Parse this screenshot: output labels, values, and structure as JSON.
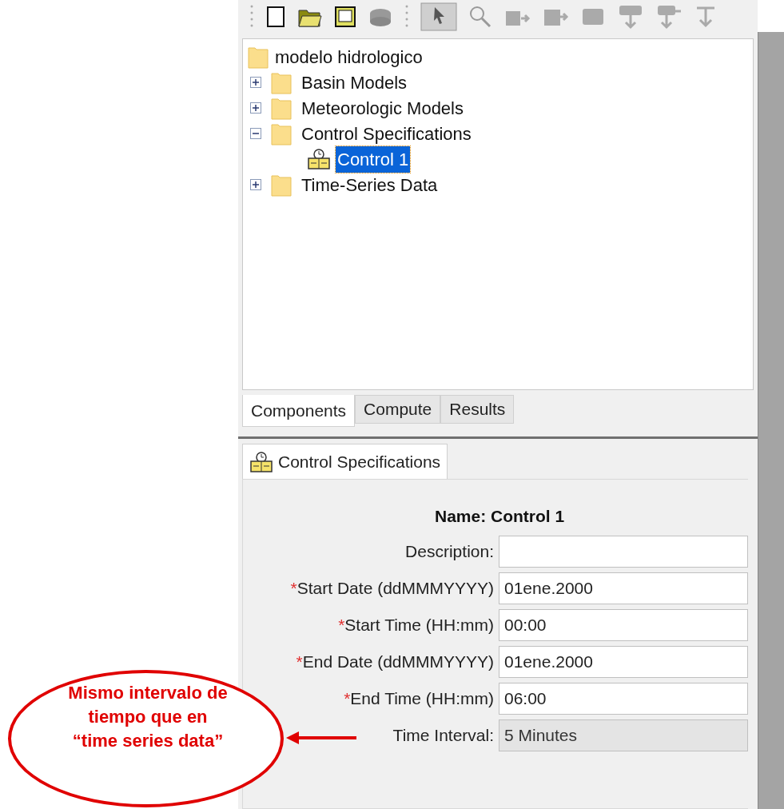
{
  "tree": {
    "label": "modelo hidrologico",
    "children": [
      {
        "label": "Basin Models",
        "expanded": false,
        "selected": false
      },
      {
        "label": "Meteorologic Models",
        "expanded": false,
        "selected": false
      },
      {
        "label": "Control Specifications",
        "expanded": true,
        "selected": false,
        "children": [
          {
            "label": "Control 1",
            "selected": true
          }
        ]
      },
      {
        "label": "Time-Series Data",
        "expanded": false,
        "selected": false
      }
    ]
  },
  "tabs": [
    {
      "label": "Components",
      "selected": true
    },
    {
      "label": "Compute",
      "selected": false
    },
    {
      "label": "Results",
      "selected": false
    }
  ],
  "editor": {
    "tab": "Control Specifications",
    "name": "Name: Control 1",
    "fields": [
      {
        "label": "Description:",
        "kind": "text"
      },
      {
        "required_mark": "*",
        "label": "Start Date (ddMMMYYYY)",
        "kind": "text",
        "value": "01ene.2000"
      },
      {
        "required_mark": "*",
        "label": "Start Time (HH:mm)",
        "kind": "text",
        "value": "00:00"
      },
      {
        "required_mark": "*",
        "label": "End Date (ddMMMYYYY)",
        "kind": "text",
        "value": "01ene.2000"
      },
      {
        "required_mark": "*",
        "label": "End Time (HH:mm)",
        "kind": "text",
        "value": "06:00"
      },
      {
        "label": "Time Interval:",
        "kind": "select",
        "value": "5 Minutes"
      }
    ]
  },
  "annotation": {
    "text": "Mismo intervalo de tiempo que en “time series data”"
  }
}
